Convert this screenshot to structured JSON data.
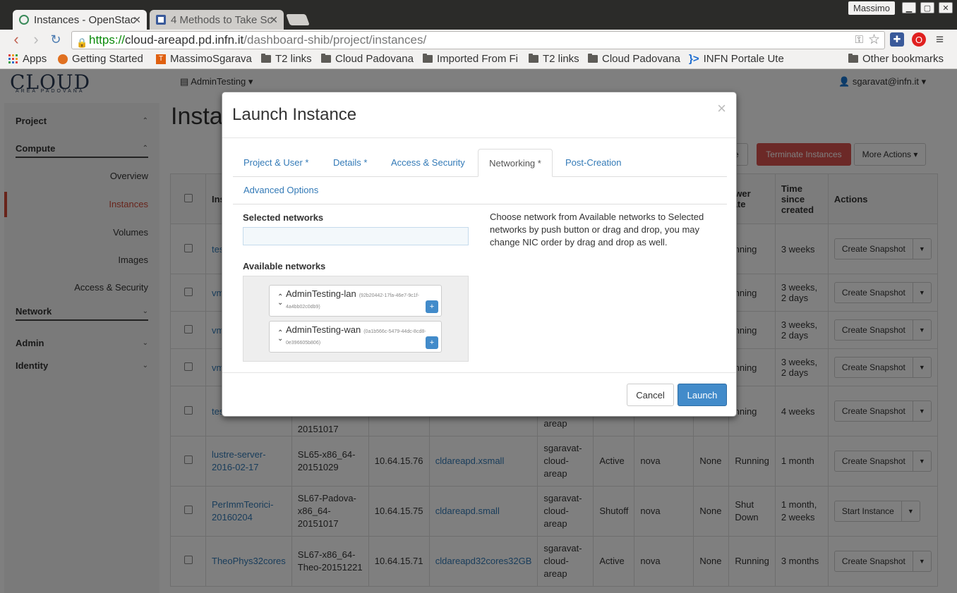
{
  "browser": {
    "tabs": [
      {
        "title": "Instances - OpenStac"
      },
      {
        "title": "4 Methods to Take Sc"
      }
    ],
    "window_user": "Massimo",
    "url_scheme": "https://",
    "url_host": "cloud-areapd.pd.infn.it",
    "url_path": "/dashboard-shib/project/instances/",
    "bookmarks": [
      {
        "label": "Apps"
      },
      {
        "label": "Getting Started"
      },
      {
        "label": "MassimoSgarava"
      },
      {
        "label": "T2 links"
      },
      {
        "label": "Cloud Padovana"
      },
      {
        "label": "Imported From Fi"
      },
      {
        "label": "T2 links"
      },
      {
        "label": "Cloud Padovana"
      },
      {
        "label": "INFN Portale Ute"
      },
      {
        "label": "Other bookmarks"
      }
    ]
  },
  "header": {
    "logo": "CL",
    "logo_o": "O",
    "logo_end": "UD",
    "logo_sub": "AREA PADOVANA",
    "project": "AdminTesting",
    "user": "sgaravat@infn.it"
  },
  "sidebar": {
    "project": "Project",
    "compute": "Compute",
    "items": [
      "Overview",
      "Instances",
      "Volumes",
      "Images",
      "Access & Security"
    ],
    "network": "Network",
    "admin": "Admin",
    "identity": "Identity"
  },
  "page": {
    "title": "Insta",
    "partial_button": "ce",
    "terminate": "Terminate Instances",
    "more_actions": "More Actions"
  },
  "table": {
    "headers": {
      "name": "Inst",
      "power": "ower\ntate",
      "time": "Time\nsince\ncreated",
      "actions": "Actions"
    },
    "rows": [
      {
        "name": "test",
        "power": "unning",
        "time": "3 weeks",
        "action": "Create Snapshot"
      },
      {
        "name": "vm3",
        "power": "unning",
        "time": "3 weeks, 2 days",
        "action": "Create Snapshot"
      },
      {
        "name": "vm2",
        "power": "unning",
        "time": "3 weeks, 2 days",
        "action": "Create Snapshot"
      },
      {
        "name": "vm1",
        "power": "unning",
        "time": "3 weeks, 2 days",
        "action": "Create Snapshot"
      },
      {
        "name": "test",
        "image": "20151017",
        "owner": "areap",
        "power": "unning",
        "time": "4 weeks",
        "action": "Create Snapshot"
      },
      {
        "name": "lustre-server-2016-02-17",
        "image": "SL65-x86_64-20151029",
        "ip": "10.64.15.76",
        "flavor": "cldareapd.xsmall",
        "owner": "sgaravat-cloud-areap",
        "status": "Active",
        "az": "nova",
        "task": "None",
        "power": "Running",
        "time": "1 month",
        "action": "Create Snapshot"
      },
      {
        "name": "PerImmTeorici-20160204",
        "image": "SL67-Padova-x86_64-20151017",
        "ip": "10.64.15.75",
        "flavor": "cldareapd.small",
        "owner": "sgaravat-cloud-areap",
        "status": "Shutoff",
        "az": "nova",
        "task": "None",
        "power": "Shut Down",
        "time": "1 month, 2 weeks",
        "action": "Start Instance"
      },
      {
        "name": "TheoPhys32cores",
        "image": "SL67-x86_64-Theo-20151221",
        "ip": "10.64.15.71",
        "flavor": "cldareapd32cores32GB",
        "owner": "sgaravat-cloud-areap",
        "status": "Active",
        "az": "nova",
        "task": "None",
        "power": "Running",
        "time": "3 months",
        "action": "Create Snapshot"
      }
    ]
  },
  "modal": {
    "title": "Launch Instance",
    "close": "×",
    "tabs": [
      "Project & User *",
      "Details *",
      "Access & Security",
      "Networking *",
      "Post-Creation",
      "Advanced Options"
    ],
    "selected_label": "Selected networks",
    "available_label": "Available networks",
    "networks": [
      {
        "name": "AdminTesting-lan",
        "id": "(92b20442-17fa-46e7-9c1f-",
        "id2": "4a4bb02c0db9)"
      },
      {
        "name": "AdminTesting-wan",
        "id": "(0a1b566c-5479-44dc-8cd8-",
        "id2": "0e396605b806)"
      }
    ],
    "help": "Choose network from Available networks to Selected networks by push button or drag and drop, you may change NIC order by drag and drop as well.",
    "cancel": "Cancel",
    "launch": "Launch"
  }
}
